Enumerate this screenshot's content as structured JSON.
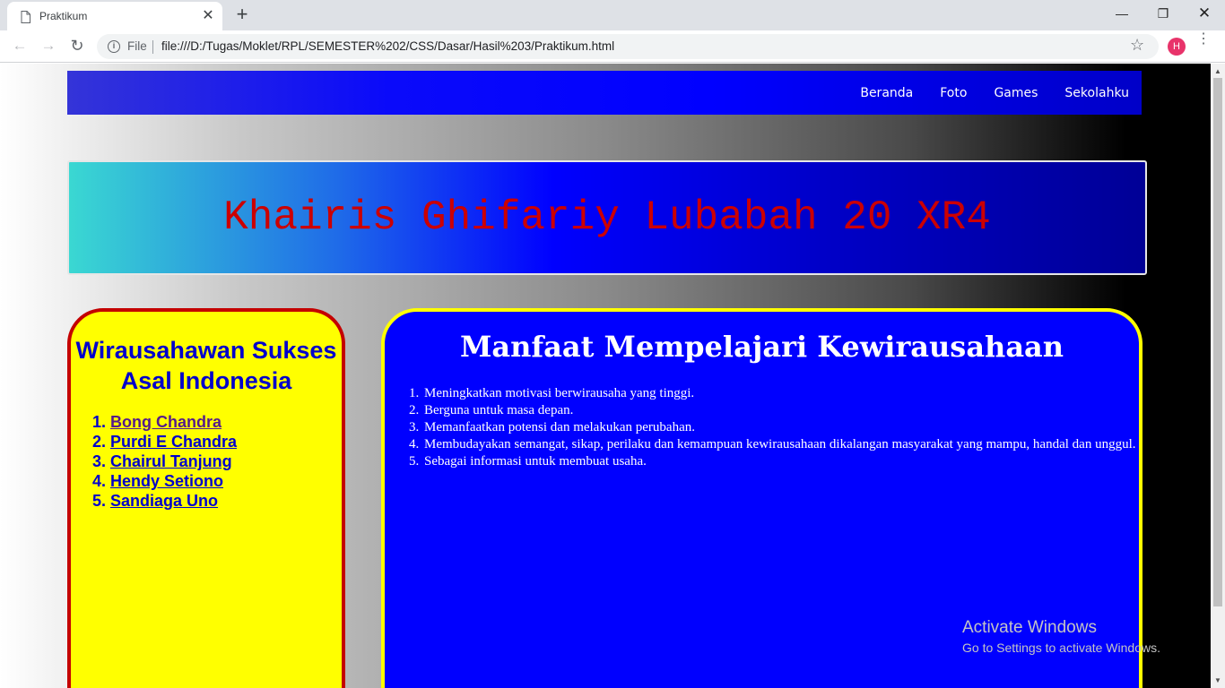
{
  "browser": {
    "tab_title": "Praktikum",
    "tab_close": "✕",
    "new_tab": "+",
    "window_minimize": "—",
    "window_maximize": "❐",
    "window_close": "✕",
    "back": "←",
    "forward": "→",
    "reload": "↻",
    "address_scheme_label": "File",
    "address_url": "file:///D:/Tugas/Moklet/RPL/SEMESTER%202/CSS/Dasar/Hasil%203/Praktikum.html",
    "bookmark_star": "☆",
    "profile_initial": "H",
    "profile_color": "#e8336a",
    "menu": "⋮"
  },
  "page": {
    "nav": {
      "items": [
        {
          "label": "Beranda"
        },
        {
          "label": "Foto"
        },
        {
          "label": "Games"
        },
        {
          "label": "Sekolahku"
        }
      ]
    },
    "banner": {
      "text": "Khairis Ghifariy Lubabah 20 XR4",
      "text_color": "#cc0000"
    },
    "left_panel": {
      "title": "Wirausahawan Sukses Asal Indonesia",
      "items": [
        {
          "label": "Bong Chandra"
        },
        {
          "label": "Purdi E Chandra"
        },
        {
          "label": "Chairul Tanjung"
        },
        {
          "label": "Hendy Setiono"
        },
        {
          "label": "Sandiaga Uno"
        }
      ],
      "background": "#ffff00",
      "border_color": "#c40000"
    },
    "right_panel": {
      "title": "Manfaat Mempelajari Kewirausahaan",
      "items": [
        {
          "text": "Meningkatkan motivasi berwirausaha yang tinggi."
        },
        {
          "text": "Berguna untuk masa depan."
        },
        {
          "text": "Memanfaatkan potensi dan melakukan perubahan."
        },
        {
          "text": "Membudayakan semangat, sikap, perilaku dan kemampuan kewirausahaan dikalangan masyarakat yang mampu, handal dan unggul."
        },
        {
          "text": "Sebagai informasi untuk membuat usaha."
        }
      ],
      "background": "#0000ff",
      "border_color": "#ffff00"
    }
  },
  "watermark": {
    "title": "Activate Windows",
    "subtitle": "Go to Settings to activate Windows."
  }
}
